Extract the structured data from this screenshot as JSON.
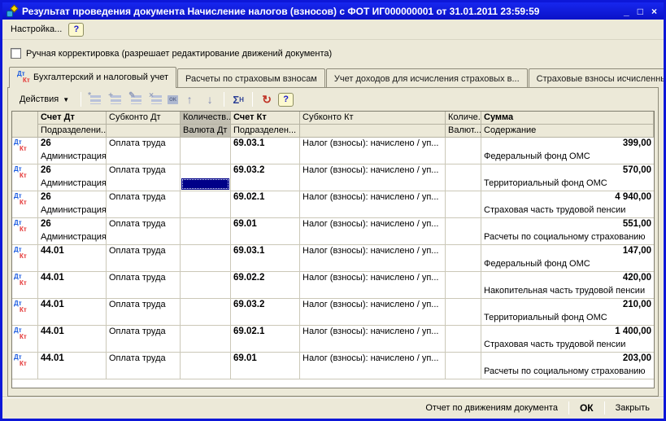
{
  "window": {
    "title": "Результат проведения документа Начисление налогов (взносов) с ФОТ ИГ000000001 от 31.01.2011 23:59:59",
    "controls": {
      "minimize": "_",
      "maximize": "□",
      "close": "×"
    }
  },
  "menu": {
    "settings_label": "Настройка...",
    "help_label": "?"
  },
  "manual_adjustment": {
    "label": "Ручная корректировка (разрешает редактирование движений документа)",
    "checked": false
  },
  "badge": {
    "dt": "Дт",
    "kt": "Кт"
  },
  "tabs": [
    {
      "label": "Бухгалтерский и налоговый учет",
      "active": true,
      "icon": "dtkt-icon"
    },
    {
      "label": "Расчеты по страховым взносам",
      "active": false
    },
    {
      "label": "Учет доходов для исчисления страховых в...",
      "active": false
    },
    {
      "label": "Страховые взносы исчисленные",
      "active": false
    }
  ],
  "toolbar": {
    "actions_label": "Действия",
    "actions_caret": "▼",
    "items": [
      {
        "sep": true
      },
      {
        "name": "add-row-icon",
        "type": "rows",
        "glyph": "*",
        "disabled": true
      },
      {
        "name": "copy-row-icon",
        "type": "rows",
        "glyph": "+",
        "disabled": true
      },
      {
        "name": "edit-row-icon",
        "type": "rows",
        "glyph": "✎",
        "disabled": true
      },
      {
        "name": "delete-row-icon",
        "type": "rows",
        "glyph": "×",
        "disabled": true
      },
      {
        "name": "save-ok-icon",
        "type": "disk",
        "glyph": "OK",
        "disabled": true
      },
      {
        "name": "move-up-icon",
        "type": "arrow",
        "glyph": "↑",
        "disabled": true
      },
      {
        "name": "move-down-icon",
        "type": "arrow",
        "glyph": "↓",
        "disabled": true
      },
      {
        "sep": true
      },
      {
        "name": "totals-icon",
        "type": "sigma",
        "glyph": "Σ",
        "sub": "H",
        "disabled": false
      },
      {
        "sep": true
      },
      {
        "name": "refresh-icon",
        "type": "refresh",
        "glyph": "↻",
        "disabled": false
      },
      {
        "name": "help-icon",
        "type": "help",
        "glyph": "?",
        "disabled": false
      }
    ]
  },
  "table": {
    "header_row1": [
      "",
      "Счет Дт",
      "Субконто Дт",
      "Количеств...",
      "Счет Кт",
      "Субконто Кт",
      "Количе...",
      "Сумма"
    ],
    "header_row2": [
      "Подразделени...",
      "",
      "Валюта Дт",
      "Подразделен...",
      "",
      "Валют...",
      "Содержание"
    ],
    "highlight_column": 3,
    "rows": [
      {
        "dt_acc": "26",
        "dt_sub": "Администрация",
        "subconto_dt": "Оплата труда",
        "kt_acc": "69.03.1",
        "kt_subconto": "Налог (взносы): начислено / уп...",
        "amount": "399,00",
        "content": "Федеральный фонд ОМС",
        "selected": false
      },
      {
        "dt_acc": "26",
        "dt_sub": "Администрация",
        "subconto_dt": "Оплата труда",
        "kt_acc": "69.03.2",
        "kt_subconto": "Налог (взносы): начислено / уп...",
        "amount": "570,00",
        "content": "Территориальный фонд ОМС",
        "selected": true
      },
      {
        "dt_acc": "26",
        "dt_sub": "Администрация",
        "subconto_dt": "Оплата труда",
        "kt_acc": "69.02.1",
        "kt_subconto": "Налог (взносы): начислено / уп...",
        "amount": "4 940,00",
        "content": "Страховая часть трудовой пенсии",
        "selected": false
      },
      {
        "dt_acc": "26",
        "dt_sub": "Администрация",
        "subconto_dt": "Оплата труда",
        "kt_acc": "69.01",
        "kt_subconto": "Налог (взносы): начислено / уп...",
        "amount": "551,00",
        "content": "Расчеты по социальному страхованию",
        "selected": false
      },
      {
        "dt_acc": "44.01",
        "dt_sub": "",
        "subconto_dt": "Оплата труда",
        "kt_acc": "69.03.1",
        "kt_subconto": "Налог (взносы): начислено / уп...",
        "amount": "147,00",
        "content": "Федеральный фонд ОМС",
        "selected": false
      },
      {
        "dt_acc": "44.01",
        "dt_sub": "",
        "subconto_dt": "Оплата труда",
        "kt_acc": "69.02.2",
        "kt_subconto": "Налог (взносы): начислено / уп...",
        "amount": "420,00",
        "content": "Накопительная часть трудовой пенсии",
        "selected": false
      },
      {
        "dt_acc": "44.01",
        "dt_sub": "",
        "subconto_dt": "Оплата труда",
        "kt_acc": "69.03.2",
        "kt_subconto": "Налог (взносы): начислено / уп...",
        "amount": "210,00",
        "content": "Территориальный фонд ОМС",
        "selected": false
      },
      {
        "dt_acc": "44.01",
        "dt_sub": "",
        "subconto_dt": "Оплата труда",
        "kt_acc": "69.02.1",
        "kt_subconto": "Налог (взносы): начислено / уп...",
        "amount": "1 400,00",
        "content": "Страховая часть трудовой пенсии",
        "selected": false
      },
      {
        "dt_acc": "44.01",
        "dt_sub": "",
        "subconto_dt": "Оплата труда",
        "kt_acc": "69.01",
        "kt_subconto": "Налог (взносы): начислено / уп...",
        "amount": "203,00",
        "content": "Расчеты по социальному страхованию",
        "selected": false
      }
    ]
  },
  "footer": {
    "report_label": "Отчет по движениям документа",
    "ok_label": "ОК",
    "close_label": "Закрыть"
  },
  "colors": {
    "titlebar": "#0d17d8",
    "window_bg": "#ece9d8",
    "selected_cell": "#000088",
    "dt_blue": "#1c5ce0",
    "kt_red": "#e43535",
    "header_highlight": "#c2bfb2"
  }
}
